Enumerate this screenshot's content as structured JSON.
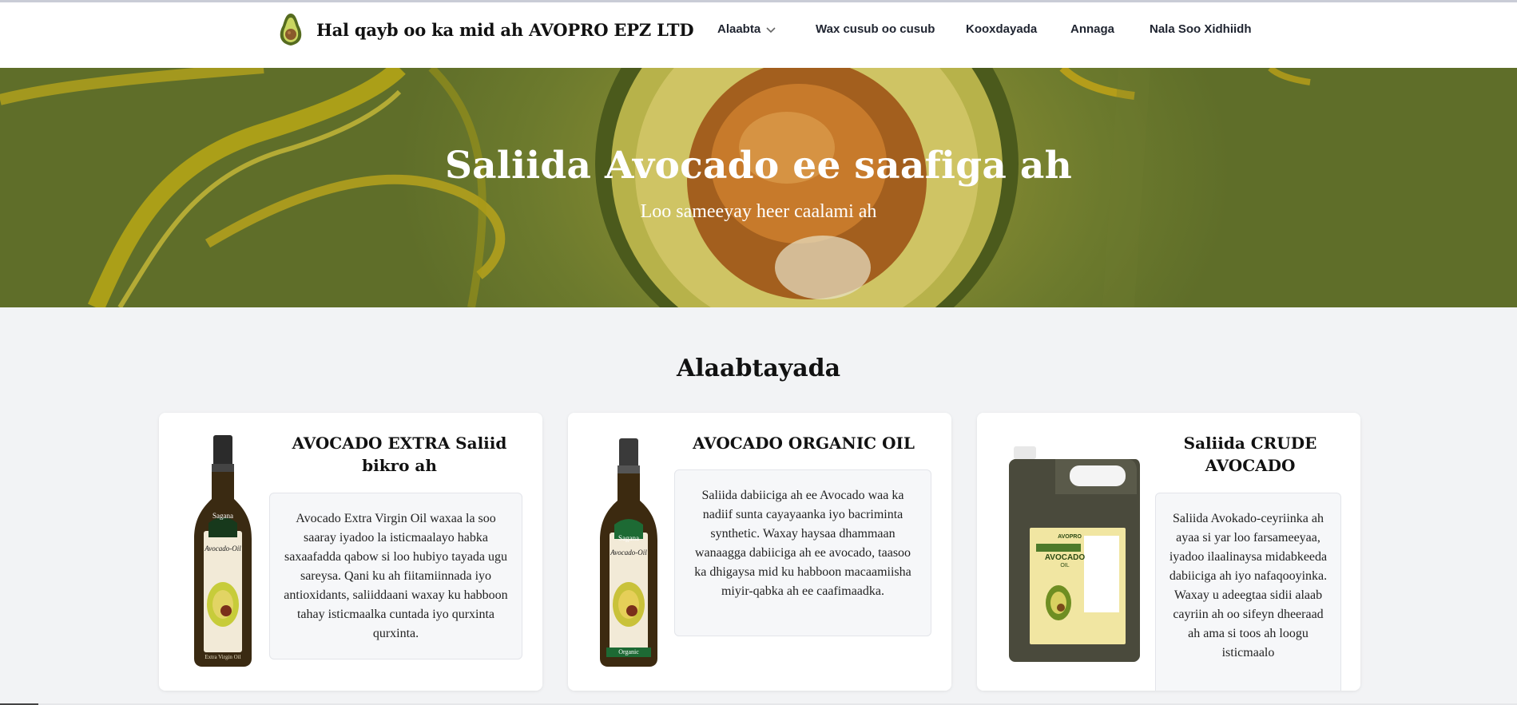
{
  "header": {
    "brand_name": "Hal qayb oo ka mid ah AVOPRO EPZ LTD",
    "logo_icon": "avocado-logo",
    "nav": [
      {
        "label": "Alaabta",
        "has_dropdown": true
      },
      {
        "label": "Wax cusub oo cusub"
      },
      {
        "label": "Kooxdayada"
      },
      {
        "label": "Annaga"
      },
      {
        "label": "Nala Soo Xidhiidh"
      }
    ]
  },
  "hero": {
    "title": "Saliida Avocado ee saafiga ah",
    "subtitle": "Loo sameeyay heer caalami ah"
  },
  "products": {
    "section_title": "Alaabtayada",
    "items": [
      {
        "title": "AVOCADO EXTRA Saliid bikro ah",
        "description": "Avocado Extra Virgin Oil waxaa la soo saaray iyadoo la isticmaalayo habka saxaafadda qabow si loo hubiyo tayada ugu sareysa. Qani ku ah fiitamiinnada iyo antioxidants, saliiddaani waxay ku habboon tahay isticmaalka cuntada iyo qurxinta qurxinta.",
        "image": "extra-virgin-oil-bottle",
        "bottle_brand": "Sagana",
        "bottle_label": "Avocado-Oil",
        "bottle_footer": "Extra Virgin Oil"
      },
      {
        "title": "AVOCADO ORGANIC OIL",
        "description": "Saliida dabiiciga ah ee Avocado waa ka nadiif sunta cayayaanka iyo bacriminta synthetic. Waxay haysaa dhammaan wanaagga dabiiciga ah ee avocado, taasoo ka dhigaysa mid ku habboon macaamiisha miyir-qabka ah ee caafimaadka.",
        "image": "organic-oil-bottle",
        "bottle_brand": "Sagana",
        "bottle_label": "Avocado-Oil",
        "bottle_footer": "Organic"
      },
      {
        "title": "Saliida CRUDE AVOCADO",
        "description": "Saliida Avokado-ceyriinka ah ayaa si yar loo farsameeyaa, iyadoo ilaalinaysa midabkeeda dabiiciga ah iyo nafaqooyinka. Waxay u adeegtaa sidii alaab cayriin ah oo sifeyn dheeraad ah ama si toos ah loogu isticmaalo",
        "image": "crude-oil-jerrycan",
        "bottle_brand": "AVOPRO",
        "bottle_label": "AVOCADO",
        "bottle_footer": "OIL"
      }
    ]
  },
  "colors": {
    "hero_olive": "#6c7a2d",
    "page_bg": "#f2f3f5",
    "card_bg": "#ffffff",
    "nav_text": "#1f2430"
  }
}
